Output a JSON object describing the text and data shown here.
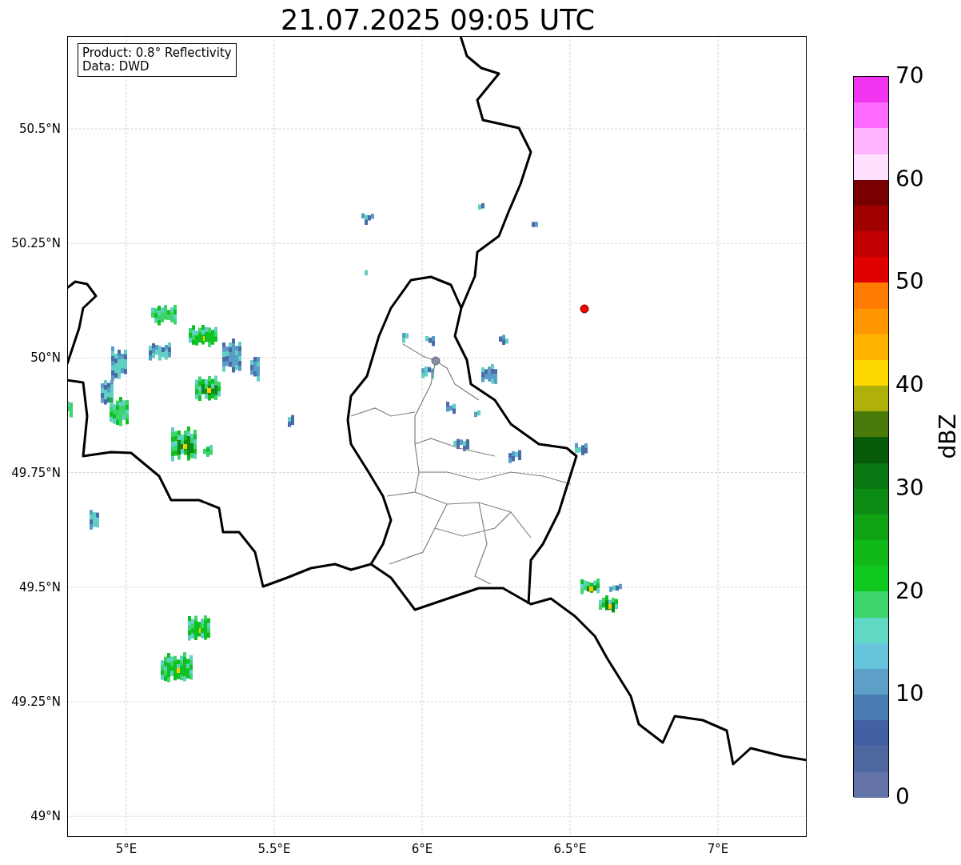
{
  "title": "21.07.2025 09:05 UTC",
  "annotation": [
    "Product: 0.8° Reflectivity",
    "Data: DWD"
  ],
  "y_ticks": [
    "50.5°N",
    "50.25°N",
    "50°N",
    "49.75°N",
    "49.5°N",
    "49.25°N",
    "49°N"
  ],
  "x_ticks": [
    "5°E",
    "5.5°E",
    "6°E",
    "6.5°E",
    "7°E"
  ],
  "colorbar": {
    "label": "dBZ",
    "ticks": [
      "70",
      "60",
      "50",
      "40",
      "30",
      "20",
      "10",
      "0"
    ],
    "segments": [
      {
        "color": "#f034f0"
      },
      {
        "color": "#ff6cff"
      },
      {
        "color": "#ffb4ff"
      },
      {
        "color": "#ffe0ff"
      },
      {
        "color": "#780000"
      },
      {
        "color": "#a00000"
      },
      {
        "color": "#c00000"
      },
      {
        "color": "#e00000"
      },
      {
        "color": "#ff7c00"
      },
      {
        "color": "#ff9800"
      },
      {
        "color": "#ffb400"
      },
      {
        "color": "#ffd700"
      },
      {
        "color": "#b0b00a"
      },
      {
        "color": "#4a7a0a"
      },
      {
        "color": "#065a0a"
      },
      {
        "color": "#0a7812"
      },
      {
        "color": "#0c8c14"
      },
      {
        "color": "#10a414"
      },
      {
        "color": "#10b818"
      },
      {
        "color": "#10c820"
      },
      {
        "color": "#3cd46c"
      },
      {
        "color": "#60d8c4"
      },
      {
        "color": "#66c4dc"
      },
      {
        "color": "#5ca0c8"
      },
      {
        "color": "#4a7cb4"
      },
      {
        "color": "#4460a4"
      },
      {
        "color": "#5068a0"
      },
      {
        "color": "#6474a8"
      }
    ]
  }
}
